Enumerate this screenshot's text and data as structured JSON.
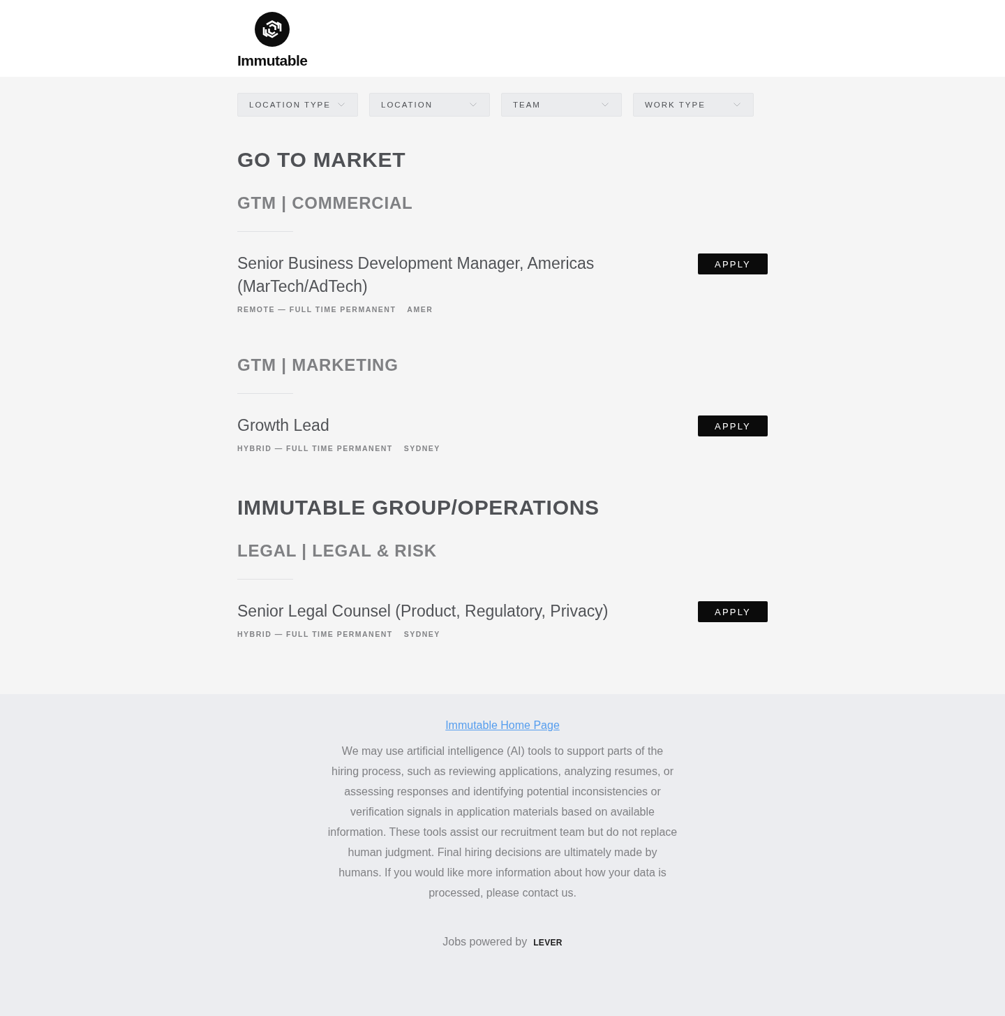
{
  "header": {
    "brand": "Immutable"
  },
  "filters": [
    "LOCATION TYPE",
    "LOCATION",
    "TEAM",
    "WORK TYPE"
  ],
  "departments": [
    {
      "title": "GO TO MARKET",
      "teams": [
        {
          "title": "GTM | COMMERCIAL",
          "postings": [
            {
              "title": "Senior Business Development Manager, Americas (MarTech/AdTech)",
              "tags": [
                "REMOTE — FULL TIME PERMANENT",
                "AMER"
              ],
              "button": "APPLY"
            }
          ]
        },
        {
          "title": "GTM | MARKETING",
          "postings": [
            {
              "title": "Growth Lead",
              "tags": [
                "HYBRID — FULL TIME PERMANENT",
                "SYDNEY"
              ],
              "button": "APPLY"
            }
          ]
        }
      ]
    },
    {
      "title": "IMMUTABLE GROUP/OPERATIONS",
      "teams": [
        {
          "title": "LEGAL | LEGAL & RISK",
          "postings": [
            {
              "title": "Senior Legal Counsel (Product, Regulatory, Privacy)",
              "tags": [
                "HYBRID — FULL TIME PERMANENT",
                "SYDNEY"
              ],
              "button": "APPLY"
            }
          ]
        }
      ]
    }
  ],
  "footer": {
    "link": "Immutable Home Page",
    "disclaimer": "We may use artificial intelligence (AI) tools to support parts of the hiring process, such as reviewing applications, analyzing resumes, or assessing responses and identifying potential inconsistencies or verification signals in application materials based on available information. These tools assist our recruitment team but do not replace human judgment. Final hiring decisions are ultimately made by humans. If you would like more information about how your data is processed, please contact us.",
    "powered_by": "Jobs powered by",
    "powered_logo": "LEVER"
  }
}
